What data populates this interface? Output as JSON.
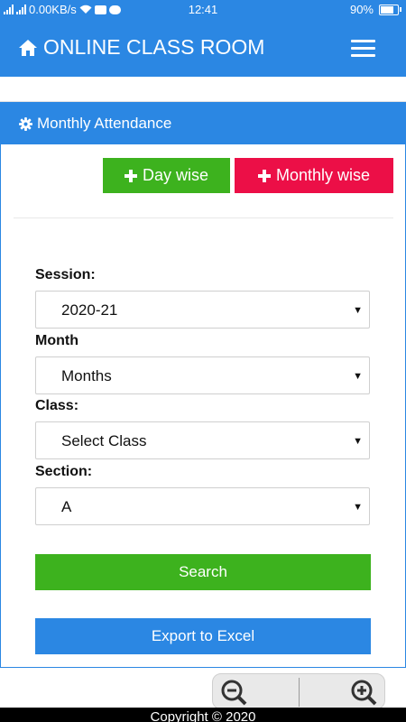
{
  "status_bar": {
    "network_speed": "0.00KB/s",
    "time": "12:41",
    "battery": "90%",
    "battery_level": 0.9,
    "icons": [
      "signal-icon",
      "signal-icon",
      "wifi-icon",
      "youtube-icon",
      "chat-icon",
      "battery-icon"
    ]
  },
  "navbar": {
    "title": "ONLINE CLASS ROOM",
    "home_icon": "home-icon",
    "menu_icon": "hamburger-menu-icon"
  },
  "card": {
    "title": "Monthly Attendance",
    "title_icon": "gear-icon",
    "buttons": {
      "day_wise": "Day wise",
      "monthly_wise": "Monthly wise"
    },
    "form": {
      "session_label": "Session:",
      "session_value": "2020-21",
      "month_label": "Month",
      "month_value": "Months",
      "class_label": "Class:",
      "class_value": "Select Class",
      "section_label": "Section:",
      "section_value": "A"
    },
    "search_label": "Search",
    "export_label": "Export to Excel"
  },
  "zoom": {
    "out_icon": "zoom-out-icon",
    "in_icon": "zoom-in-icon"
  },
  "footer": {
    "text": "Copyright © 2020"
  },
  "colors": {
    "primary": "#2b87e3",
    "success": "#3db21e",
    "danger": "#ec0f47"
  }
}
